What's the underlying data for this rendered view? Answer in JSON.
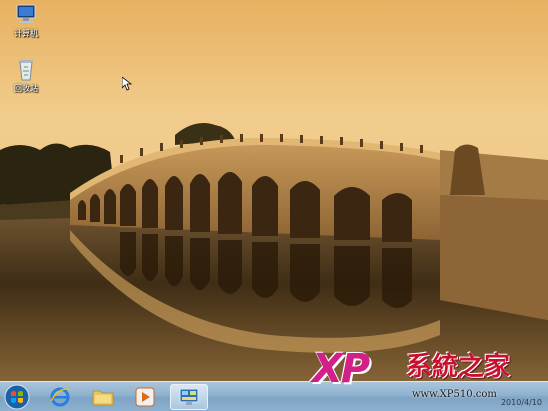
{
  "desktop": {
    "icons": [
      {
        "label": "计算机",
        "icon": "computer-icon"
      },
      {
        "label": "回收站",
        "icon": "recycle-bin-icon"
      }
    ]
  },
  "taskbar": {
    "buttons": [
      {
        "icon": "windows-start-icon"
      },
      {
        "icon": "internet-explorer-icon"
      },
      {
        "icon": "folder-icon"
      },
      {
        "icon": "media-player-icon"
      },
      {
        "icon": "control-panel-icon"
      }
    ],
    "clock_date": "2010/4/10"
  },
  "watermark": {
    "logo": "XP",
    "title": "系統之家",
    "url": "www.XP510.com"
  },
  "colors": {
    "sky": "#e9b76a",
    "water": "#3a2a15",
    "watermark_pink": "#d21f8a",
    "watermark_red": "#c8102e"
  }
}
